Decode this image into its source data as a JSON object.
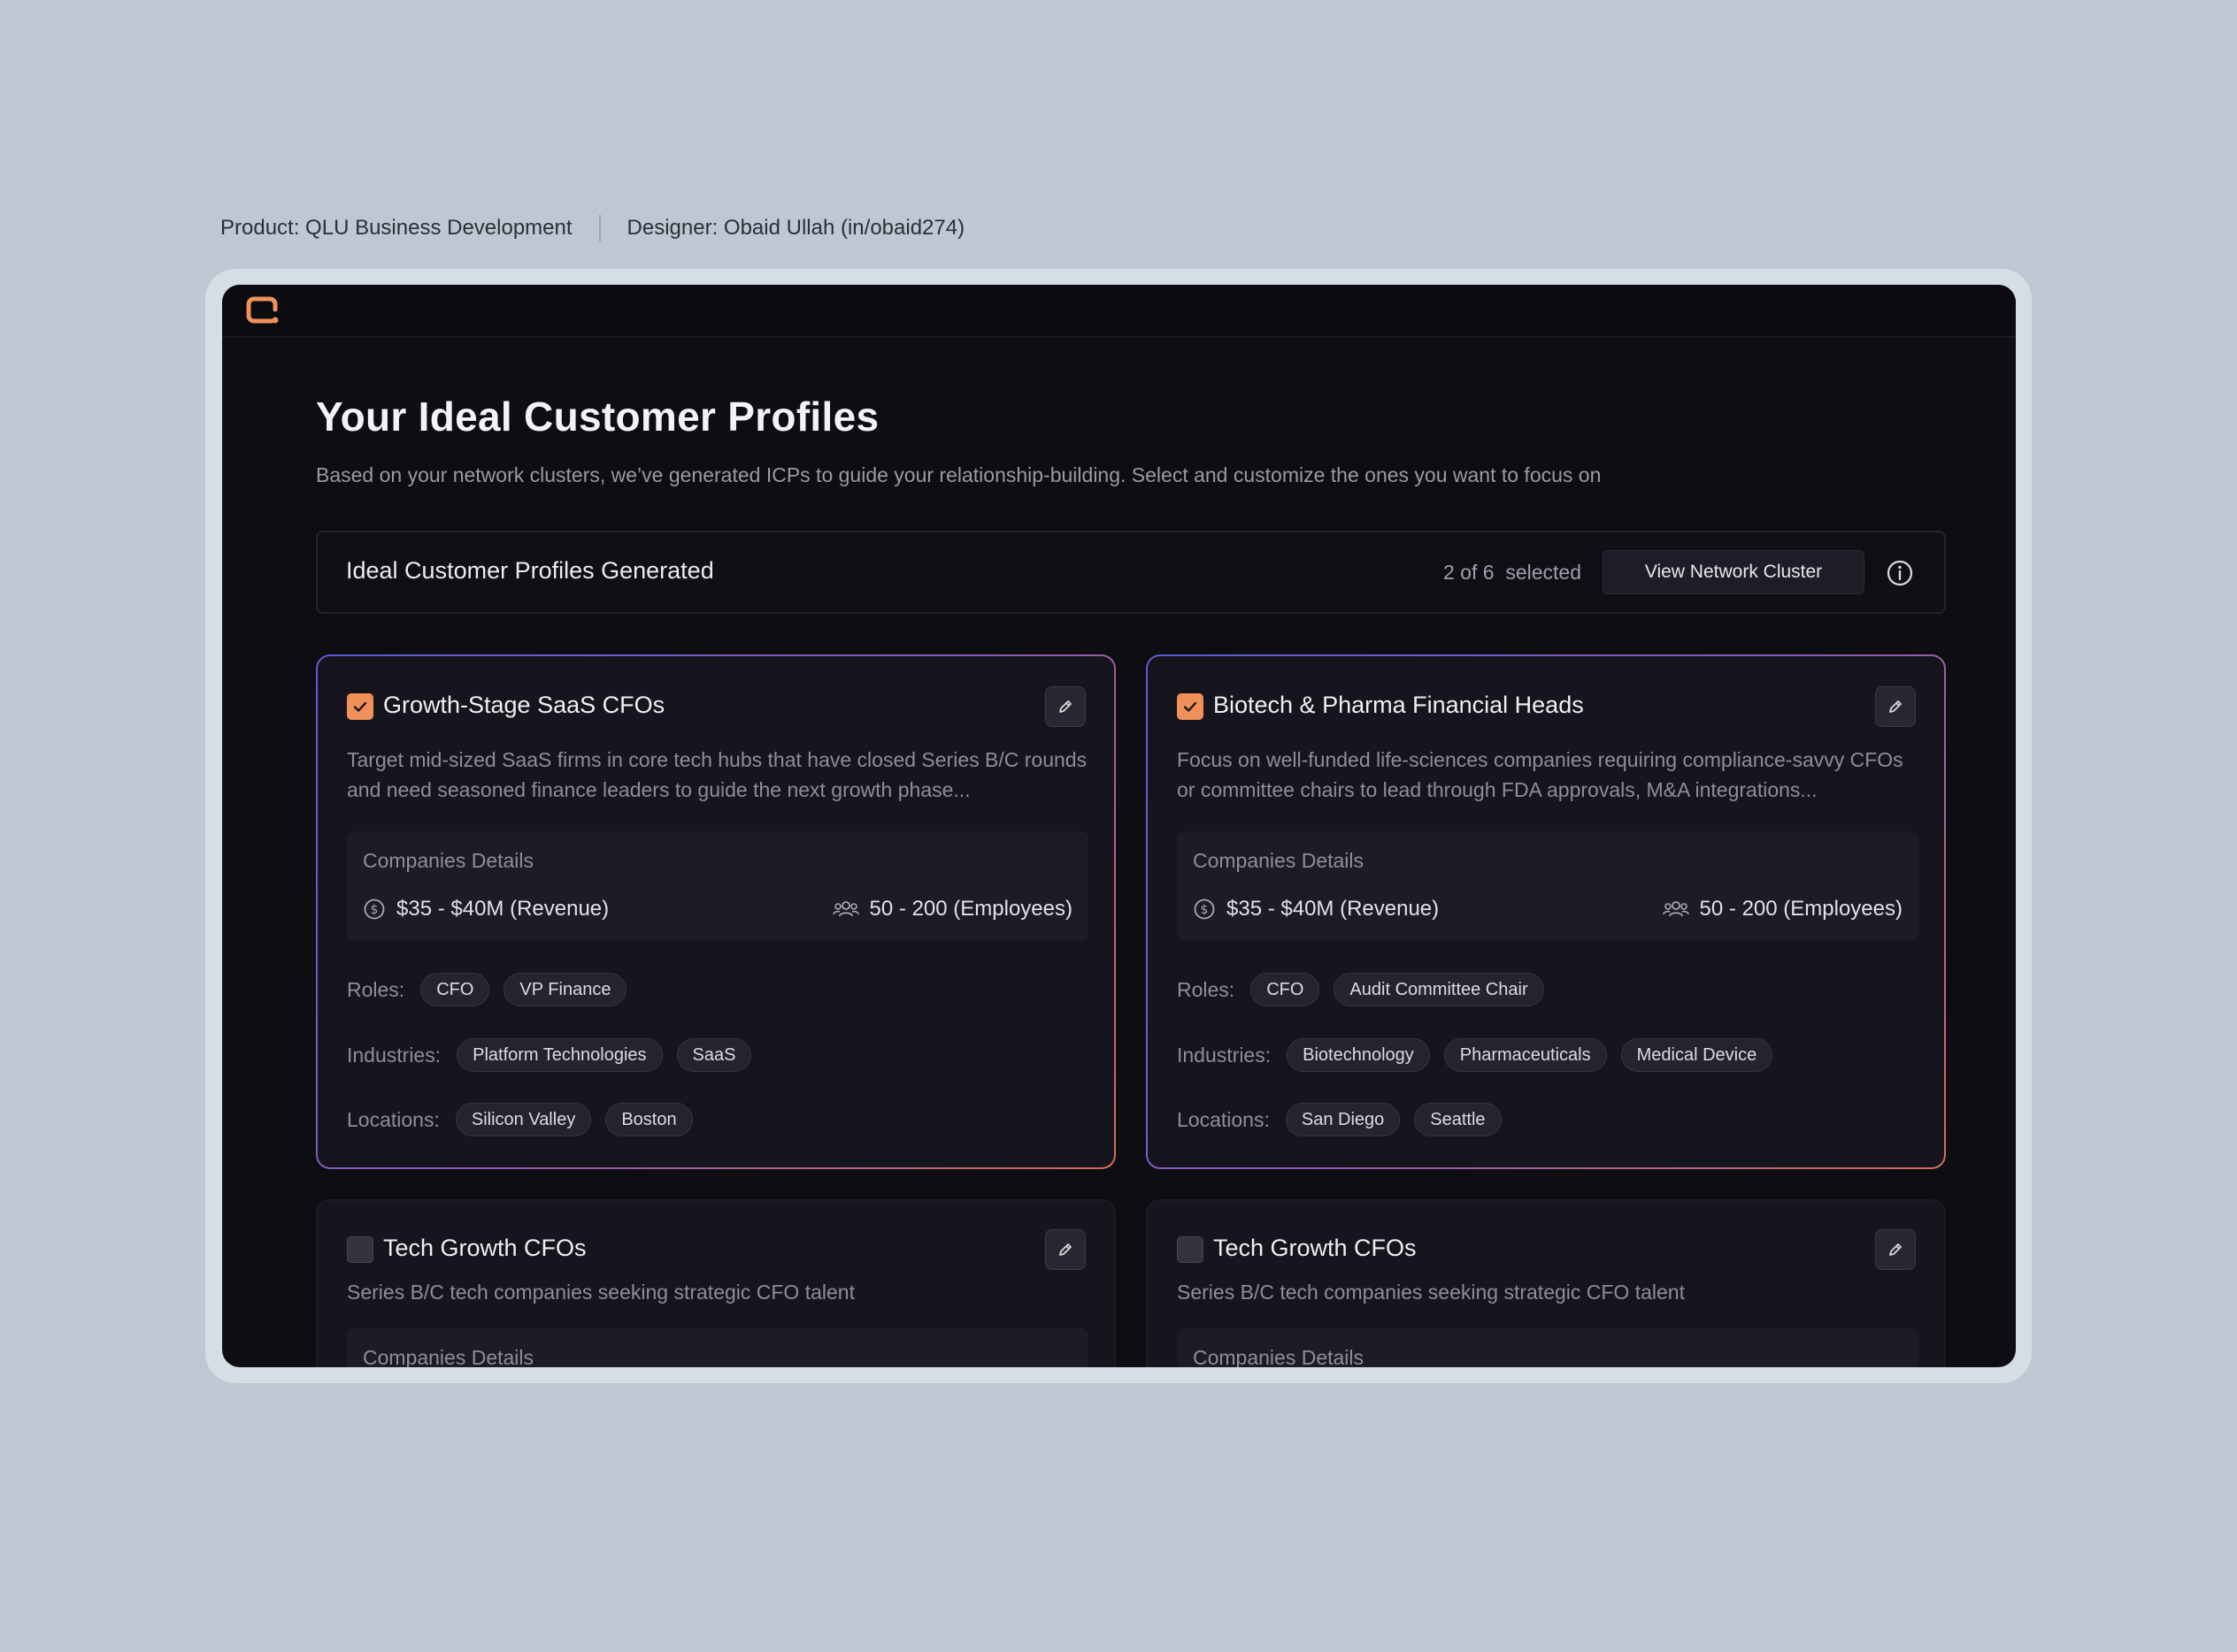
{
  "meta": {
    "product": "Product: QLU Business Development",
    "designer": "Designer: Obaid Ullah (in/obaid274)"
  },
  "header": {
    "logo_icon": "qlu-logo-icon",
    "accent": "#f0905a"
  },
  "page": {
    "title": "Your Ideal Customer Profiles",
    "subtitle": "Based on your network clusters, we’ve generated ICPs to guide your relationship-building. Select and customize the ones you want to focus on"
  },
  "summary": {
    "title": "Ideal Customer Profiles Generated",
    "count": "2 of 6  selected",
    "view_cluster_label": "View Network Cluster",
    "info_icon": "info-icon"
  },
  "labels": {
    "companies_details": "Companies Details",
    "roles": "Roles:",
    "industries": "Industries:",
    "locations": "Locations:"
  },
  "cards": [
    {
      "selected": true,
      "title": "Growth-Stage SaaS CFOs",
      "description": "Target mid-sized SaaS firms in core tech hubs that have closed Series B/C rounds and need seasoned finance leaders to guide the next growth phase...",
      "revenue": "$35 - $40M (Revenue)",
      "employees": "50 - 200 (Employees)",
      "roles": [
        "CFO",
        "VP Finance"
      ],
      "industries": [
        "Platform Technologies",
        "SaaS"
      ],
      "locations": [
        "Silicon Valley",
        "Boston"
      ]
    },
    {
      "selected": true,
      "title": "Biotech & Pharma Financial Heads",
      "description": "Focus on well-funded life-sciences companies requiring compliance-savvy CFOs or committee chairs to lead through FDA approvals, M&A integrations...",
      "revenue": "$35 - $40M (Revenue)",
      "employees": "50 - 200 (Employees)",
      "roles": [
        "CFO",
        "Audit Committee Chair"
      ],
      "industries": [
        "Biotechnology",
        "Pharmaceuticals",
        "Medical Device"
      ],
      "locations": [
        "San Diego",
        "Seattle"
      ]
    },
    {
      "selected": false,
      "title": "Tech Growth CFOs",
      "description": "Series B/C tech companies seeking strategic CFO talent"
    },
    {
      "selected": false,
      "title": "Tech Growth CFOs",
      "description": "Series B/C tech companies seeking strategic CFO talent"
    }
  ]
}
